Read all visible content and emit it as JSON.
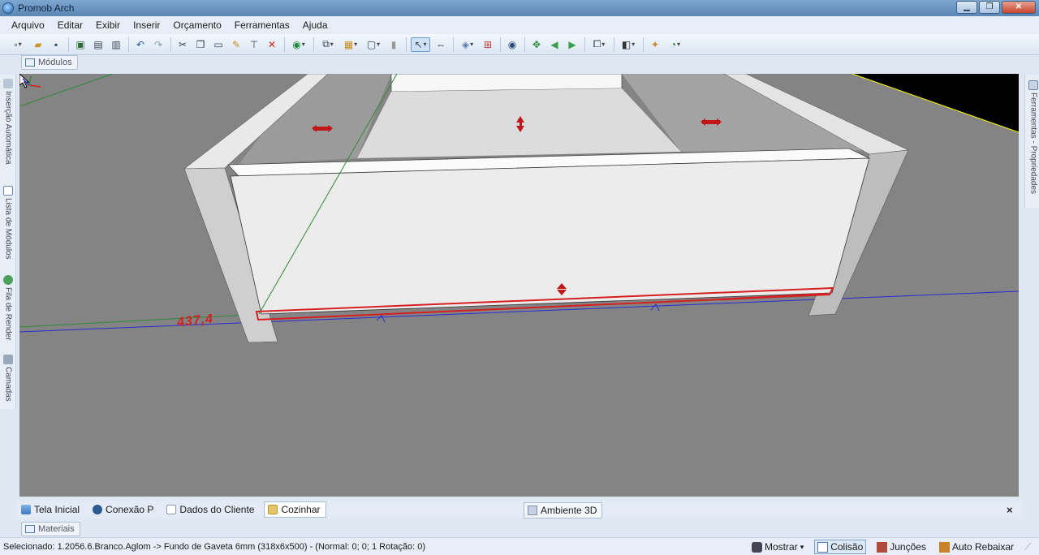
{
  "window": {
    "title": "Promob Arch",
    "minimize": "▁",
    "maximize": "❐",
    "close": "✕"
  },
  "menu": [
    "Arquivo",
    "Editar",
    "Exibir",
    "Inserir",
    "Orçamento",
    "Ferramentas",
    "Ajuda"
  ],
  "panels": {
    "modules": "Módulos",
    "materials": "Materiais",
    "left_tabs": [
      "Inserção Automática",
      "Lista de Módulos",
      "Fila de Render",
      "Camadas"
    ],
    "right_tabs": [
      "Ferramentas - Propriedades"
    ]
  },
  "viewport": {
    "dimension_label": "437,4"
  },
  "doc_tabs": [
    "Tela Inicial",
    "Conexão P",
    "Dados do Cliente",
    "Cozinhar"
  ],
  "active_doc_tab": "Cozinhar",
  "view_tab": "Ambiente 3D",
  "doc_close": "×",
  "status": {
    "selected_text": "Selecionado: 1.2056.6.Branco.Aglom -> Fundo de Gaveta 6mm (318x6x500) - (Normal: 0; 0; 1 Rotação: 0)",
    "mostrar": "Mostrar",
    "colisao": "Colisão",
    "juncoes": "Junções",
    "auto_rebaixar": "Auto Rebaixar"
  },
  "colors": {
    "viewport_bg": "#848484",
    "accent_red": "#d42020",
    "title_bar": "#5b86b5"
  }
}
